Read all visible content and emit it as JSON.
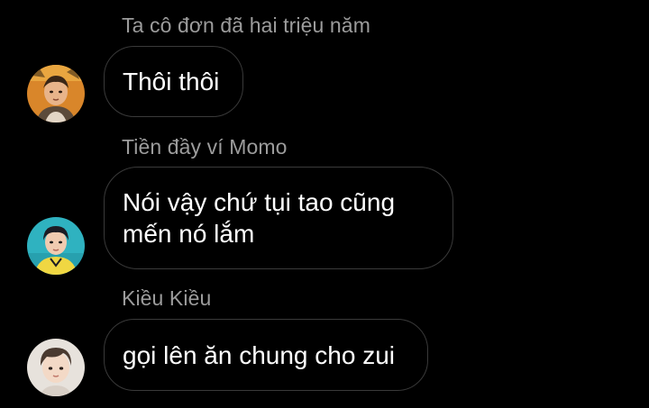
{
  "messages": [
    {
      "sender": "Ta cô đơn đã hai triệu năm",
      "text": "Thôi thôi",
      "avatar": {
        "name": "avatar-orange-bg-person",
        "bg": "#d9862a"
      }
    },
    {
      "sender": "Tiền đầy ví Momo",
      "text": "Nói vậy chứ tụi tao cũng mến nó lắm",
      "avatar": {
        "name": "avatar-teal-bg-person",
        "bg": "#2fb2c0"
      }
    },
    {
      "sender": "Kiều Kiều",
      "text": "gọi lên ăn chung cho zui",
      "avatar": {
        "name": "avatar-light-bg-person",
        "bg": "#e7e2dc"
      }
    }
  ],
  "colors": {
    "background": "#000000",
    "sender_name": "#9c9c9c",
    "bubble_border": "#3a3a3a",
    "message_text": "#ffffff"
  }
}
